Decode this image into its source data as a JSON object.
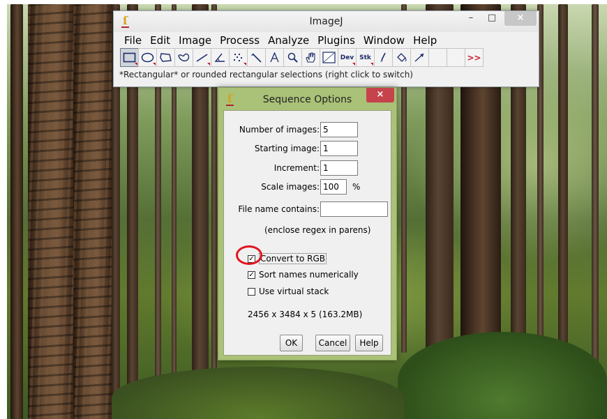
{
  "imagej": {
    "title": "ImageJ",
    "controls": {
      "minimize": "–",
      "maximize": "□",
      "close": "×"
    },
    "menu": [
      "File",
      "Edit",
      "Image",
      "Process",
      "Analyze",
      "Plugins",
      "Window",
      "Help"
    ],
    "tools": [
      {
        "name": "rectangle-tool-icon",
        "selected": true
      },
      {
        "name": "oval-tool-icon"
      },
      {
        "name": "polygon-tool-icon"
      },
      {
        "name": "freehand-tool-icon"
      },
      {
        "name": "line-tool-icon"
      },
      {
        "name": "angle-tool-icon"
      },
      {
        "name": "point-tool-icon"
      },
      {
        "name": "wand-tool-icon"
      },
      {
        "name": "text-tool-icon"
      },
      {
        "name": "magnifier-tool-icon"
      },
      {
        "name": "scroll-tool-icon"
      },
      {
        "name": "color-picker-tool-icon"
      },
      {
        "name": "dev-tool",
        "label": "Dev"
      },
      {
        "name": "stk-tool",
        "label": "Stk"
      },
      {
        "name": "brush-tool-icon"
      },
      {
        "name": "flood-fill-tool-icon"
      },
      {
        "name": "arrow-tool-icon"
      },
      {
        "name": "empty-tool-slot"
      },
      {
        "name": "empty-tool-slot"
      },
      {
        "name": "more-tools-icon",
        "label": ">>"
      }
    ],
    "status": "*Rectangular* or rounded rectangular selections (right click to switch)"
  },
  "dialog": {
    "title": "Sequence Options",
    "close": "×",
    "fields": {
      "num_images_label": "Number of images:",
      "num_images": "5",
      "start_label": "Starting image:",
      "start": "1",
      "increment_label": "Increment:",
      "increment": "1",
      "scale_label": "Scale images:",
      "scale": "100",
      "scale_unit": "%",
      "filename_label": "File name contains:",
      "filename": "",
      "regex_hint": "(enclose regex in parens)"
    },
    "checkboxes": {
      "convert_rgb": "Convert to RGB",
      "sort_numeric": "Sort names numerically",
      "virtual_stack": "Use virtual stack"
    },
    "info": "2456 x 3484 x 5 (163.2MB)",
    "buttons": {
      "ok": "OK",
      "cancel": "Cancel",
      "help": "Help"
    }
  },
  "colors": {
    "dialog_frame": "#aac178",
    "highlight": "#e0141c",
    "tool_icon": "#1c2b6a"
  }
}
